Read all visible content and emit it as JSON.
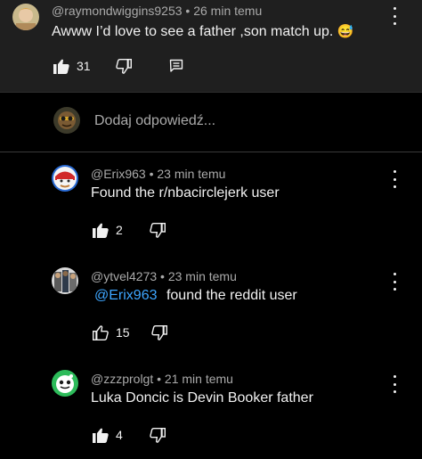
{
  "top_comment": {
    "author": "@raymondwiggins9253",
    "time": "26 min temu",
    "separator": "•",
    "text": "Awww I’d love to see a father ,son match up.",
    "emoji": "😅",
    "likes": "31"
  },
  "reply_box": {
    "placeholder": "Dodaj odpowiedź..."
  },
  "replies": [
    {
      "author": "@Erix963",
      "time": "23 min temu",
      "text": "Found the r/nbacirclejerk user",
      "likes": "2",
      "liked": true
    },
    {
      "author": "@ytvel4273",
      "time": "23 min temu",
      "mention": "@Erix963",
      "text": "found the reddit user",
      "likes": "15",
      "liked": false
    },
    {
      "author": "@zzzprolgt",
      "time": "21 min temu",
      "text": "Luka Doncic is Devin Booker father",
      "likes": "4",
      "liked": true
    }
  ],
  "colors": {
    "background": "#0f0f0f",
    "top_panel": "#1f1f1f",
    "mention": "#3ea6ff",
    "meta_text": "#aaaaaa"
  }
}
